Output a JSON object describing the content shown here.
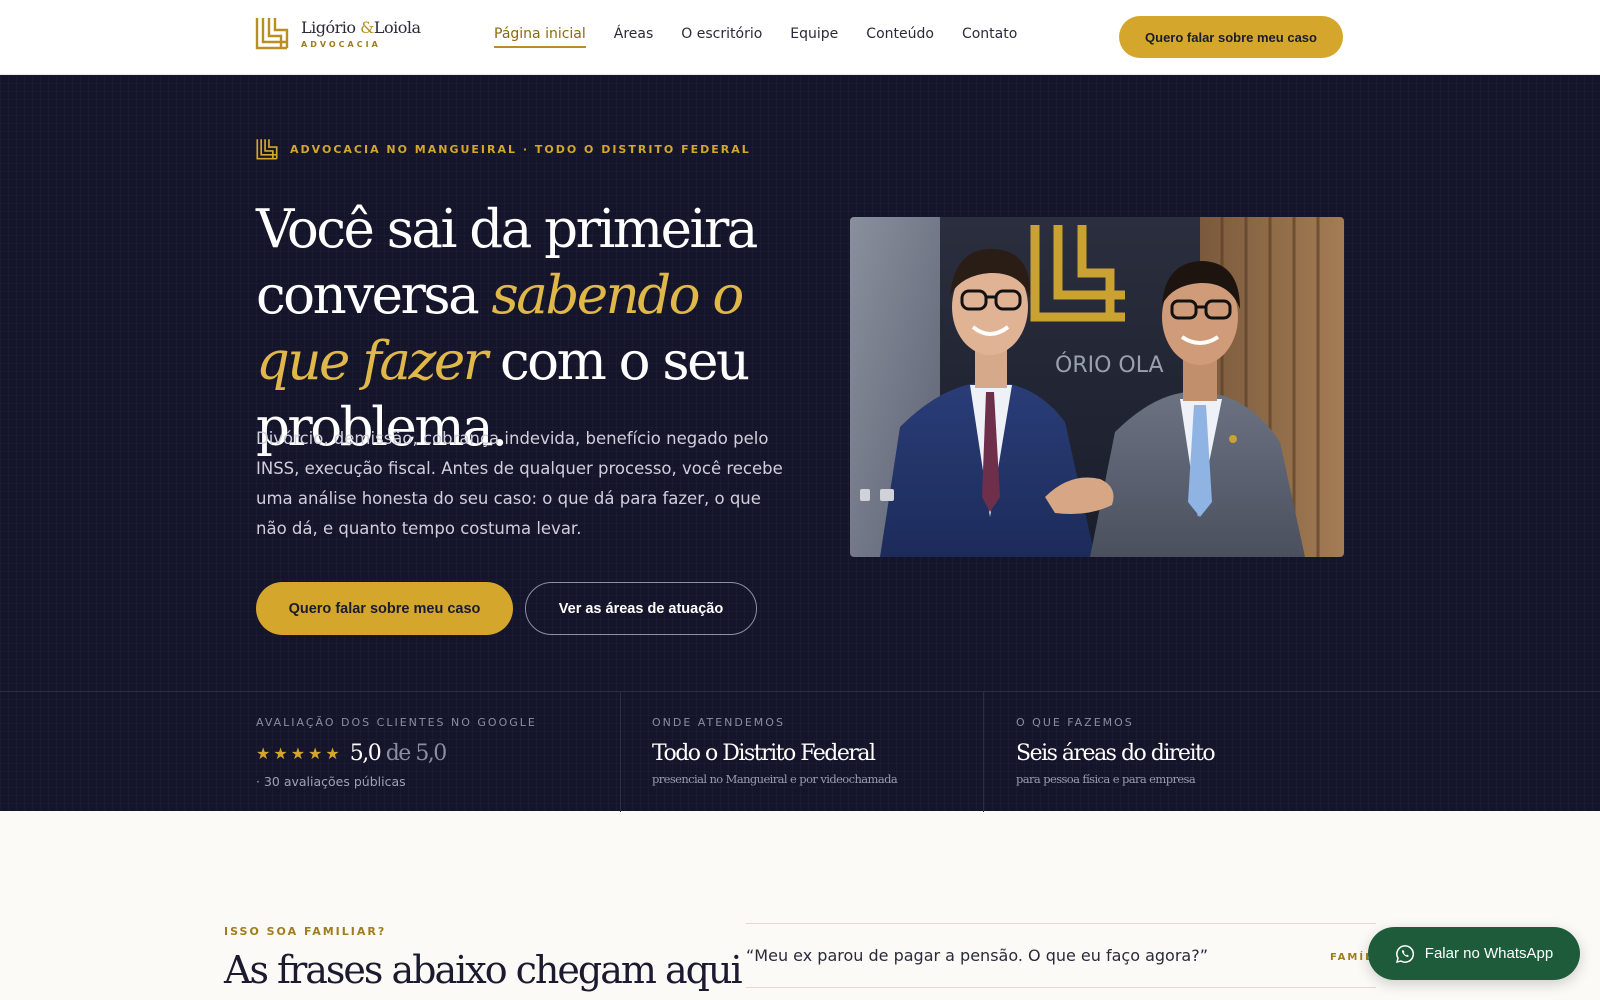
{
  "header": {
    "logo": {
      "name_part1": "Ligório",
      "amp": "&",
      "name_part2": "Loiola",
      "subtitle": "ADVOCACIA"
    },
    "nav": [
      {
        "label": "Página inicial",
        "active": true
      },
      {
        "label": "Áreas",
        "active": false
      },
      {
        "label": "O escritório",
        "active": false
      },
      {
        "label": "Equipe",
        "active": false
      },
      {
        "label": "Conteúdo",
        "active": false
      },
      {
        "label": "Contato",
        "active": false
      }
    ],
    "cta_label": "Quero falar sobre meu caso"
  },
  "hero": {
    "eyebrow": "ADVOCACIA NO MANGUEIRAL · TODO O DISTRITO FEDERAL",
    "title_part1": "Você sai da primeira conversa ",
    "title_accent": "sabendo o que fazer",
    "title_part2": " com o seu problema.",
    "description": "Divórcio, demissão, cobrança indevida, benefício negado pelo INSS, execução fiscal. Antes de qualquer processo, você recebe uma análise honesta do seu caso: o que dá para fazer, o que não dá, e quanto tempo costuma levar.",
    "primary_button": "Quero falar sobre meu caso",
    "secondary_button": "Ver as áreas de atuação",
    "photo_sign_text": "ÓRIO OLA"
  },
  "stats": {
    "rating": {
      "label": "AVALIAÇÃO DOS CLIENTES NO GOOGLE",
      "stars": 5,
      "value": "5,0",
      "of": "de 5,0",
      "note": "· 30 avaliações públicas"
    },
    "location": {
      "label": "ONDE ATENDEMOS",
      "value": "Todo o Distrito Federal",
      "note": "presencial no Mangueiral e por videochamada"
    },
    "services": {
      "label": "O QUE FAZEMOS",
      "value": "Seis áreas do direito",
      "note": "para pessoa física e para empresa"
    }
  },
  "section": {
    "eyebrow": "ISSO SOA FAMILIAR?",
    "title": "As frases abaixo chegam aqui",
    "quote": "“Meu ex parou de pagar a pensão. O que eu faço agora?”",
    "quote_tag": "FAMÍLI"
  },
  "whatsapp": {
    "label": "Falar no WhatsApp"
  },
  "colors": {
    "navy": "#14142a",
    "gold": "#d4a72c",
    "gold_text": "#e0b84a",
    "whatsapp_green": "#1e5b3a",
    "cream": "#fbfaf6"
  }
}
